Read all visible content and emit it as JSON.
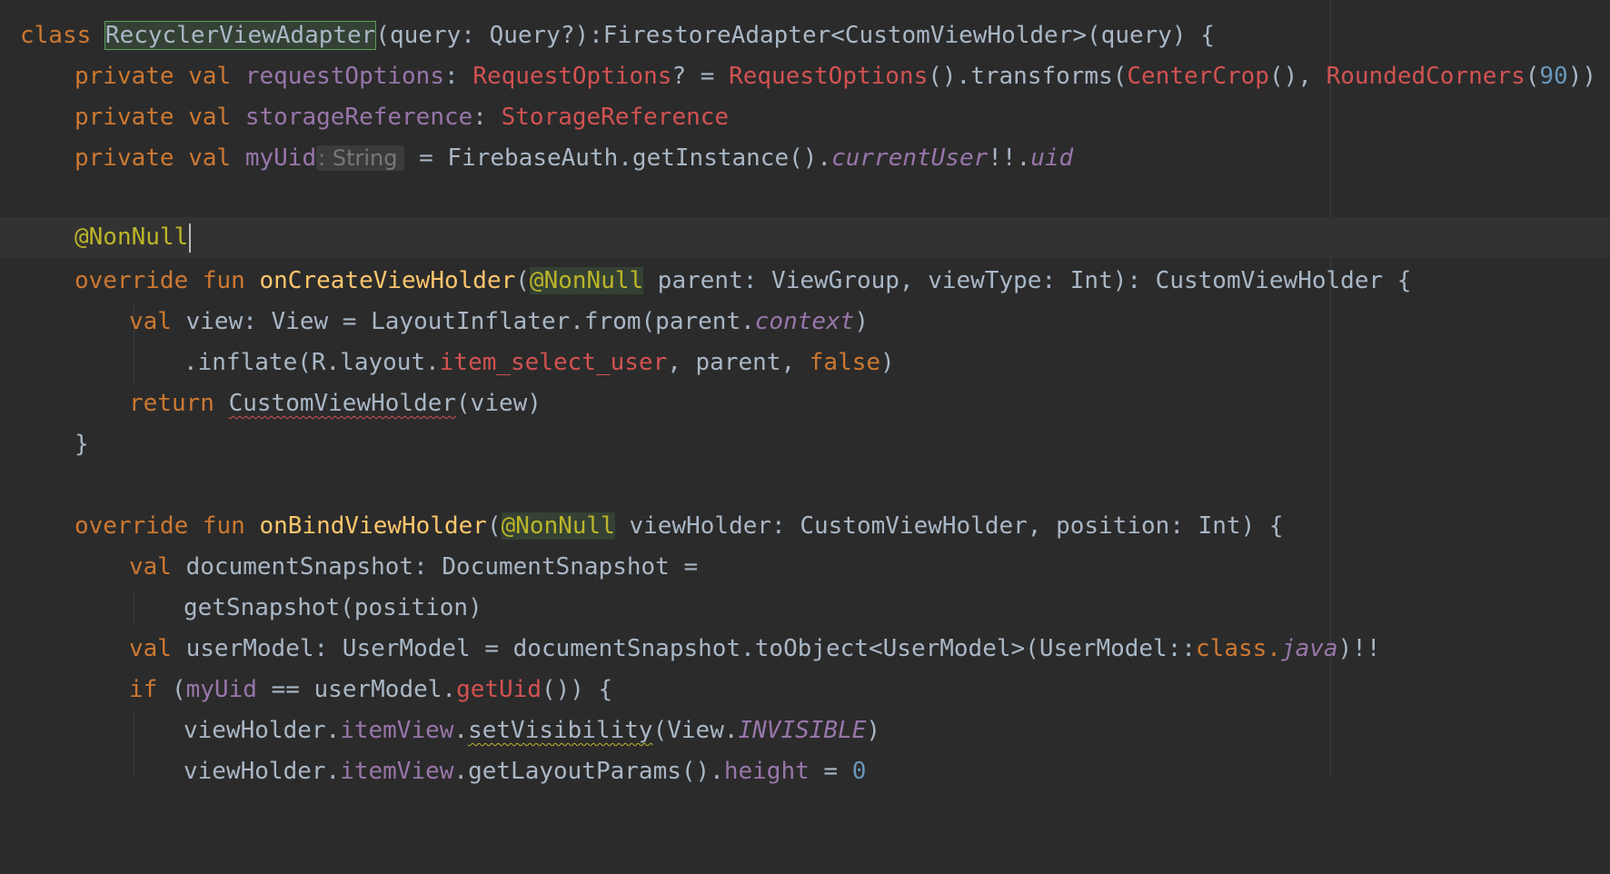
{
  "editor": {
    "colors": {
      "background": "#2b2b2b",
      "keyword": "#cc7832",
      "annotation": "#bbb529",
      "function": "#ffc66d",
      "property": "#9876aa",
      "error_red": "#d25252",
      "number": "#6897bb",
      "plain": "#a9b7c6"
    },
    "lines": {
      "l1": {
        "kw_class": "class ",
        "class_name": "RecyclerViewAdapter",
        "rest": "(query: Query?):FirestoreAdapter<CustomViewHolder>(query) {"
      },
      "l2": {
        "kw": "private val ",
        "prop": "requestOptions",
        "colon": ": ",
        "type": "RequestOptions",
        "eq": "? = ",
        "ctor": "RequestOptions",
        "call": "().transforms(",
        "crop": "CenterCrop",
        "comma": "(), ",
        "rounded": "RoundedCorners",
        "open": "(",
        "num": "90",
        "close": "))"
      },
      "l3": {
        "kw": "private val ",
        "prop": "storageReference",
        "colon": ": ",
        "type": "StorageReference"
      },
      "l4": {
        "kw": "private val ",
        "prop": "myUid",
        "hint": ": String",
        "rest": " = FirebaseAuth.getInstance().",
        "user": "currentUser",
        "bang": "!!.",
        "uid": "uid"
      },
      "l6": {
        "annotation": "@NonNull"
      },
      "l7": {
        "kw": "override fun ",
        "fn": "onCreateViewHolder",
        "open": "(",
        "ann": "@NonNull",
        "rest": " parent: ViewGroup, viewType: Int): CustomViewHolder {"
      },
      "l8": {
        "kw": "val ",
        "rest": "view: View = LayoutInflater.from(parent.",
        "ctx": "context",
        "close": ")"
      },
      "l9": {
        "rest": ".inflate(R.layout.",
        "res": "item_select_user",
        "mid": ", parent, ",
        "falsekw": "false",
        "close": ")"
      },
      "l10": {
        "kw": "return ",
        "ctor": "CustomViewHolder",
        "rest": "(view)"
      },
      "l11": {
        "brace": "}"
      },
      "l13": {
        "kw": "override fun ",
        "fn": "onBindViewHolder",
        "open": "(",
        "ann": "@NonNull",
        "rest": " viewHolder: CustomViewHolder, position: Int) {"
      },
      "l14": {
        "kw": "val ",
        "rest": "documentSnapshot: DocumentSnapshot ="
      },
      "l15": {
        "rest": "getSnapshot(position)"
      },
      "l16": {
        "kw": "val ",
        "rest": "userModel: UserModel = documentSnapshot.toObject<UserModel>(UserModel::",
        "classkw": "class",
        "dot": ".",
        "java": "java",
        "tail": ")!!"
      },
      "l17": {
        "kw": "if ",
        "open": "(",
        "prop": "myUid",
        "mid": " == userModel.",
        "getuid": "getUid",
        "tail": "()) {"
      },
      "l18": {
        "obj": "viewHolder.",
        "item": "itemView",
        "dot": ".",
        "setvis": "setVisibility",
        "open": "(View.",
        "inv": "INVISIBLE",
        "close": ")"
      },
      "l19": {
        "obj": "viewHolder.",
        "item": "itemView",
        "mid": ".getLayoutParams().",
        "height": "height",
        "eq": " = ",
        "num": "0"
      }
    }
  }
}
